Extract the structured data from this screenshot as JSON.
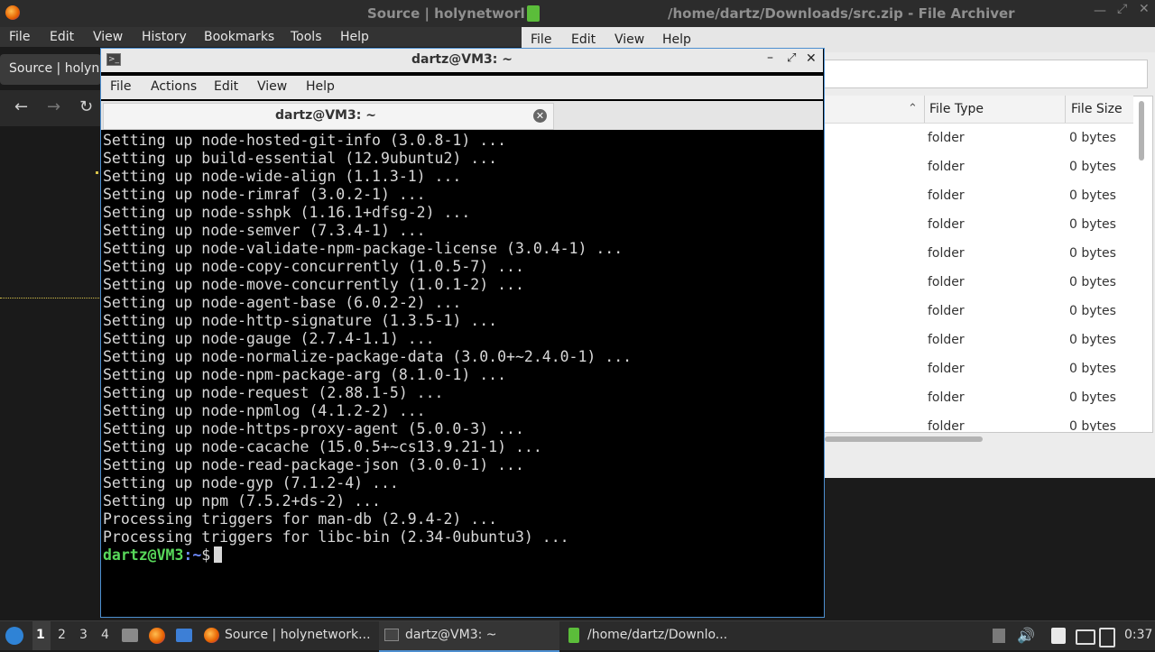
{
  "firefox": {
    "window_title": "Source | holynetworl",
    "menu": [
      "File",
      "Edit",
      "View",
      "History",
      "Bookmarks",
      "Tools",
      "Help"
    ],
    "tab_label": "Source | holyne"
  },
  "archiver": {
    "window_title": "/home/dartz/Downloads/src.zip - File Archiver",
    "menu": [
      "File",
      "Edit",
      "View",
      "Help"
    ],
    "columns": [
      "File Type",
      "File Size"
    ],
    "rows": [
      {
        "type": "folder",
        "size": "0 bytes"
      },
      {
        "type": "folder",
        "size": "0 bytes"
      },
      {
        "type": "folder",
        "size": "0 bytes"
      },
      {
        "type": "folder",
        "size": "0 bytes"
      },
      {
        "type": "folder",
        "size": "0 bytes"
      },
      {
        "type": "folder",
        "size": "0 bytes"
      },
      {
        "type": "folder",
        "size": "0 bytes"
      },
      {
        "type": "folder",
        "size": "0 bytes"
      },
      {
        "type": "folder",
        "size": "0 bytes"
      },
      {
        "type": "folder",
        "size": "0 bytes"
      },
      {
        "type": "folder",
        "size": "0 bytes"
      }
    ]
  },
  "terminal": {
    "title": "dartz@VM3: ~",
    "menu": [
      "File",
      "Actions",
      "Edit",
      "View",
      "Help"
    ],
    "tab_label": "dartz@VM3: ~",
    "lines": [
      "Setting up node-hosted-git-info (3.0.8-1) ...",
      "Setting up build-essential (12.9ubuntu2) ...",
      "Setting up node-wide-align (1.1.3-1) ...",
      "Setting up node-rimraf (3.0.2-1) ...",
      "Setting up node-sshpk (1.16.1+dfsg-2) ...",
      "Setting up node-semver (7.3.4-1) ...",
      "Setting up node-validate-npm-package-license (3.0.4-1) ...",
      "Setting up node-copy-concurrently (1.0.5-7) ...",
      "Setting up node-move-concurrently (1.0.1-2) ...",
      "Setting up node-agent-base (6.0.2-2) ...",
      "Setting up node-http-signature (1.3.5-1) ...",
      "Setting up node-gauge (2.7.4-1.1) ...",
      "Setting up node-normalize-package-data (3.0.0+~2.4.0-1) ...",
      "Setting up node-npm-package-arg (8.1.0-1) ...",
      "Setting up node-request (2.88.1-5) ...",
      "Setting up node-npmlog (4.1.2-2) ...",
      "Setting up node-https-proxy-agent (5.0.0-3) ...",
      "Setting up node-cacache (15.0.5+~cs13.9.21-1) ...",
      "Setting up node-read-package-json (3.0.0-1) ...",
      "Setting up node-gyp (7.1.2-4) ...",
      "Setting up npm (7.5.2+ds-2) ...",
      "Processing triggers for man-db (2.9.4-2) ...",
      "Processing triggers for libc-bin (2.34-0ubuntu3) ..."
    ],
    "prompt_user": "dartz@VM3",
    "prompt_path": ":~",
    "prompt_symbol": "$"
  },
  "taskbar": {
    "workspaces": [
      "1",
      "2",
      "3",
      "4"
    ],
    "tasks": [
      "Source | holynetwork...",
      "dartz@VM3: ~",
      "/home/dartz/Downlo..."
    ],
    "clock": "0:37"
  }
}
